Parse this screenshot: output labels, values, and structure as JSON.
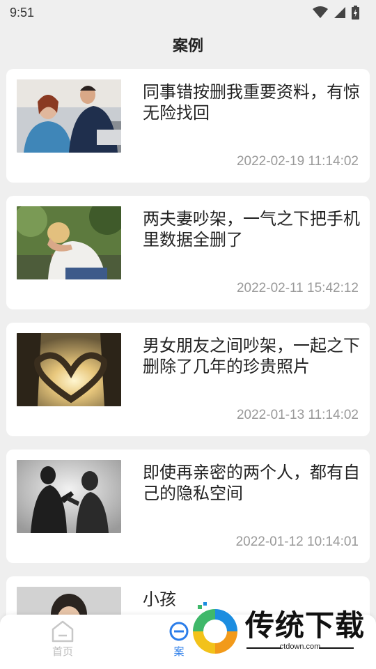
{
  "status_bar": {
    "time": "9:51"
  },
  "header": {
    "title": "案例"
  },
  "cards": [
    {
      "title": "同事错按删我重要资料，有惊无险找回",
      "date": "2022-02-19 11:14:02",
      "image": "coworkers-photo"
    },
    {
      "title": "两夫妻吵架，一气之下把手机里数据全删了",
      "date": "2022-02-11 15:42:12",
      "image": "upset-woman-photo"
    },
    {
      "title": "男女朋友之间吵架，一起之下删除了几年的珍贵照片",
      "date": "2022-01-13 11:14:02",
      "image": "heart-hands-photo"
    },
    {
      "title": "即使再亲密的两个人，都有自己的隐私空间",
      "date": "2022-01-12 10:14:01",
      "image": "silhouette-argue-photo"
    },
    {
      "title": "小孩",
      "date": "",
      "image": "child-photo"
    }
  ],
  "tabbar": {
    "tabs": [
      {
        "label": "首页",
        "icon": "home-icon",
        "active": false
      },
      {
        "label": "案",
        "icon": "case-icon",
        "active": true
      }
    ]
  },
  "watermark": {
    "title": "传统下载",
    "url": "ctdown.com"
  },
  "colors": {
    "accent": "#2b7de9",
    "background": "#efefef",
    "date": "#999999"
  }
}
